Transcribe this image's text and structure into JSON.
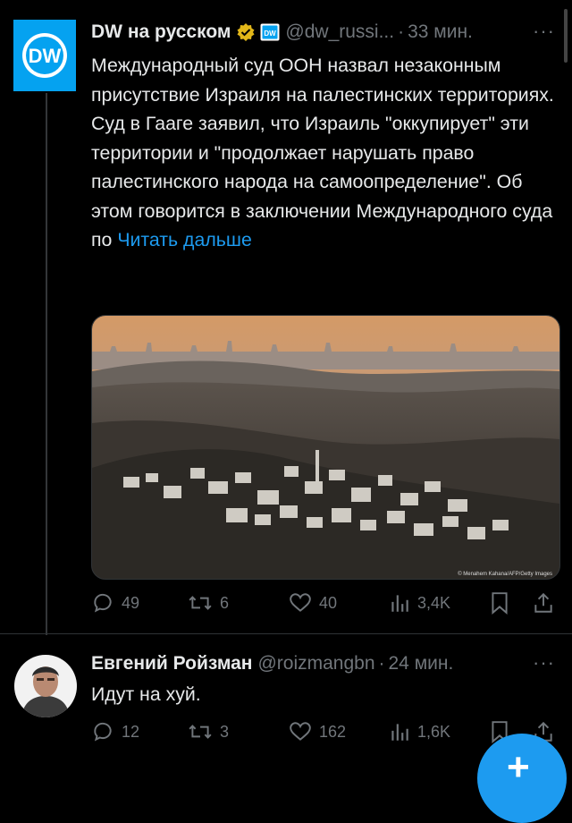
{
  "tweet1": {
    "author_name": "DW на русском",
    "handle": "@dw_russi...",
    "separator": "·",
    "time": "33 мин.",
    "more": "···",
    "text": "Международный суд ООН назвал незаконным присутствие Израиля на палестинских территориях. Суд в Гааге заявил, что Израиль \"оккупирует\" эти территории и \"продолжает нарушать право палестинского народа на самоопределение\". Об этом говорится в заключении Международного суда по",
    "read_more": "Читать дальше",
    "image_credit": "© Menahem Kahana/AFP/Getty Images",
    "replies": "49",
    "reposts": "6",
    "likes": "40",
    "views": "3,4K"
  },
  "tweet2": {
    "author_name": "Евгений Ройзман",
    "handle": "@roizmangbn",
    "separator": "·",
    "time": "24 мин.",
    "more": "···",
    "text": "Идут на хуй.",
    "replies": "12",
    "reposts": "3",
    "likes": "162",
    "views": "1,6K"
  },
  "colors": {
    "background": "#000000",
    "text": "#e7e9ea",
    "secondary": "#71767b",
    "accent": "#1d9bf0",
    "verified_gold": "#e2b719",
    "dw_blue": "#05a2f0"
  },
  "icons": [
    "reply-icon",
    "repost-icon",
    "like-icon",
    "views-icon",
    "bookmark-icon",
    "share-icon",
    "verified-badge-icon",
    "affiliate-badge-icon",
    "compose-plus-icon"
  ]
}
